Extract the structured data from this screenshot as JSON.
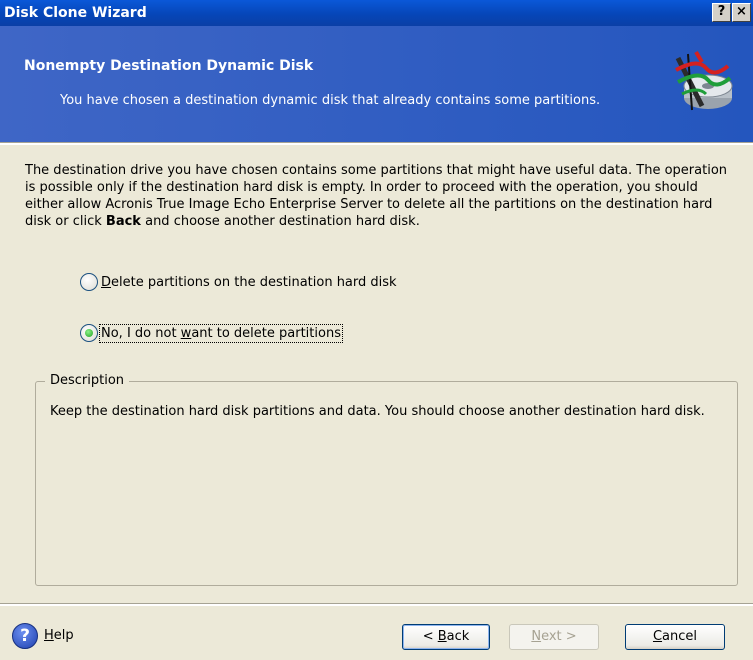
{
  "window": {
    "title": "Disk Clone Wizard",
    "help_glyph": "?",
    "close_glyph": "×"
  },
  "header": {
    "title": "Nonempty Destination Dynamic Disk",
    "subtitle": "You have chosen a destination dynamic disk that already contains some partitions.",
    "icon": "disk-clone-icon"
  },
  "intro": {
    "text_before_bold": "The destination drive you have chosen contains some partitions that might have useful data. The operation is possible only if the destination hard disk is empty. In order to proceed with the operation, you should either allow Acronis True Image Echo Enterprise Server to delete all the partitions on the destination hard disk or click ",
    "bold": "Back",
    "text_after_bold": " and choose another destination hard disk."
  },
  "options": [
    {
      "accel": "D",
      "rest": "elete partitions on the destination hard disk",
      "checked": false
    },
    {
      "before": "No, I do not ",
      "accel": "w",
      "rest": "ant to delete partitions",
      "checked": true
    }
  ],
  "description": {
    "legend": "Description",
    "text": "Keep the destination hard disk partitions and data. You should choose another destination hard disk."
  },
  "footer": {
    "help_icon": "help-icon",
    "help_accel": "H",
    "help_rest": "elp",
    "back": {
      "before": "< ",
      "accel": "B",
      "rest": "ack"
    },
    "next": {
      "accel": "N",
      "rest": "ext >"
    },
    "cancel": {
      "accel": "C",
      "rest": "ancel"
    }
  }
}
